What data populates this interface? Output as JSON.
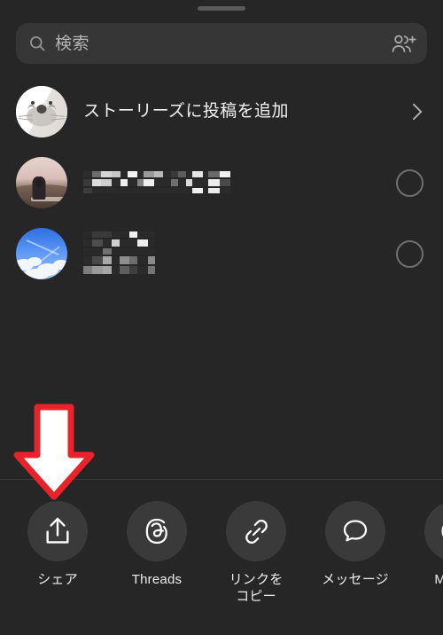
{
  "app": {
    "sheet_title": "share-sheet",
    "background_color": "#262626",
    "accent_color": "#e8232a"
  },
  "search": {
    "placeholder": "検索",
    "value": "",
    "search_icon": "search-icon",
    "add_people_icon": "add-people-icon"
  },
  "story_row": {
    "label": "ストーリーズに投稿を追加",
    "avatar_icon": "seal-avatar",
    "chevron_icon": "chevron-right-icon"
  },
  "contacts": [
    {
      "name_redacted": true,
      "name": "",
      "avatar_icon": "photo-avatar-person-landscape",
      "selector_icon": "unselected-circle-icon",
      "mosaic_lines": [
        [
          {
            "w": 10,
            "h": 7,
            "c": "#2d2d2d"
          },
          {
            "w": 10,
            "h": 7,
            "c": "#6d6d6d"
          },
          {
            "w": 12,
            "h": 7,
            "c": "#d6d6d6"
          },
          {
            "w": 10,
            "h": 7,
            "c": "#c8c8c8"
          },
          {
            "w": 8,
            "h": 7,
            "c": "#2a2a2a"
          },
          {
            "w": 11,
            "h": 7,
            "c": "#f2f2f2"
          },
          {
            "w": 7,
            "h": 7,
            "c": "#2a2a2a"
          },
          {
            "w": 12,
            "h": 7,
            "c": "#9a9a9a"
          },
          {
            "w": 10,
            "h": 7,
            "c": "#b9b9b9"
          },
          {
            "w": 9,
            "h": 7,
            "c": "#2b2b2b"
          },
          {
            "w": 8,
            "h": 7,
            "c": "#3a3a3a"
          },
          {
            "w": 9,
            "h": 7,
            "c": "#5c5c5c"
          },
          {
            "w": 7,
            "h": 7,
            "c": "#2a2a2a"
          },
          {
            "w": 12,
            "h": 7,
            "c": "#e6e6e6"
          },
          {
            "w": 6,
            "h": 7,
            "c": "#2c2c2c"
          },
          {
            "w": 13,
            "h": 7,
            "c": "#6a6a6a"
          },
          {
            "w": 12,
            "h": 7,
            "c": "#efefef"
          }
        ],
        [
          {
            "w": 10,
            "h": 8,
            "c": "#3a3a3a"
          },
          {
            "w": 10,
            "h": 8,
            "c": "#dedede"
          },
          {
            "w": 12,
            "h": 8,
            "c": "#cfcfcf"
          },
          {
            "w": 10,
            "h": 8,
            "c": "#2c2c2c"
          },
          {
            "w": 8,
            "h": 8,
            "c": "#ededed"
          },
          {
            "w": 11,
            "h": 8,
            "c": "#2b2b2b"
          },
          {
            "w": 7,
            "h": 8,
            "c": "#858585"
          },
          {
            "w": 12,
            "h": 8,
            "c": "#efefef"
          },
          {
            "w": 10,
            "h": 8,
            "c": "#2a2a2a"
          },
          {
            "w": 9,
            "h": 8,
            "c": "#2a2a2a"
          },
          {
            "w": 8,
            "h": 8,
            "c": "#6f6f6f"
          },
          {
            "w": 9,
            "h": 8,
            "c": "#2a2a2a"
          },
          {
            "w": 7,
            "h": 8,
            "c": "#dadada"
          },
          {
            "w": 12,
            "h": 8,
            "c": "#2b2b2b"
          },
          {
            "w": 6,
            "h": 8,
            "c": "#2c2c2c"
          },
          {
            "w": 13,
            "h": 8,
            "c": "#ececec"
          },
          {
            "w": 12,
            "h": 8,
            "c": "#4a4a4a"
          }
        ],
        [
          {
            "w": 10,
            "h": 6,
            "c": "#3d3d3d"
          },
          {
            "w": 10,
            "h": 6,
            "c": "#2b2b2b"
          },
          {
            "w": 12,
            "h": 6,
            "c": "#2b2b2b"
          },
          {
            "w": 10,
            "h": 6,
            "c": "#2a2a2a"
          },
          {
            "w": 8,
            "h": 6,
            "c": "#2a2a2a"
          },
          {
            "w": 11,
            "h": 6,
            "c": "#2a2a2a"
          },
          {
            "w": 7,
            "h": 6,
            "c": "#2a2a2a"
          },
          {
            "w": 12,
            "h": 6,
            "c": "#2a2a2a"
          },
          {
            "w": 10,
            "h": 6,
            "c": "#2a2a2a"
          },
          {
            "w": 9,
            "h": 6,
            "c": "#2a2a2a"
          },
          {
            "w": 8,
            "h": 6,
            "c": "#2a2a2a"
          },
          {
            "w": 9,
            "h": 6,
            "c": "#2a2a2a"
          },
          {
            "w": 7,
            "h": 6,
            "c": "#2a2a2a"
          },
          {
            "w": 12,
            "h": 6,
            "c": "#f0f0f0"
          },
          {
            "w": 6,
            "h": 6,
            "c": "#2a2a2a"
          },
          {
            "w": 13,
            "h": 6,
            "c": "#ececec"
          },
          {
            "w": 12,
            "h": 6,
            "c": "#2b2b2b"
          }
        ]
      ]
    },
    {
      "name_redacted": true,
      "name": "",
      "avatar_icon": "photo-avatar-blue-sky",
      "selector_icon": "unselected-circle-icon",
      "mosaic_lines": [
        [
          {
            "w": 10,
            "h": 7,
            "c": "#2a2a2a"
          },
          {
            "w": 12,
            "h": 7,
            "c": "#3b3b3b"
          },
          {
            "w": 10,
            "h": 7,
            "c": "#3a3a3a"
          },
          {
            "w": 9,
            "h": 7,
            "c": "#2b2b2b"
          },
          {
            "w": 11,
            "h": 7,
            "c": "#2a2a2a"
          },
          {
            "w": 9,
            "h": 7,
            "c": "#f0f0f0"
          },
          {
            "w": 12,
            "h": 7,
            "c": "#2b2b2b"
          },
          {
            "w": 8,
            "h": 7,
            "c": "#2a2a2a"
          }
        ],
        [
          {
            "w": 10,
            "h": 8,
            "c": "#2b2b2b"
          },
          {
            "w": 12,
            "h": 8,
            "c": "#4d4d4d"
          },
          {
            "w": 10,
            "h": 8,
            "c": "#2c2c2c"
          },
          {
            "w": 9,
            "h": 8,
            "c": "#cfcfcf"
          },
          {
            "w": 11,
            "h": 8,
            "c": "#2b2b2b"
          },
          {
            "w": 9,
            "h": 8,
            "c": "#2b2b2b"
          },
          {
            "w": 12,
            "h": 8,
            "c": "#ededed"
          },
          {
            "w": 8,
            "h": 8,
            "c": "#2a2a2a"
          }
        ],
        [
          {
            "w": 10,
            "h": 7,
            "c": "#2a2a2a"
          },
          {
            "w": 12,
            "h": 7,
            "c": "#2a2a2a"
          },
          {
            "w": 10,
            "h": 7,
            "c": "#6f6f6f"
          },
          {
            "w": 9,
            "h": 7,
            "c": "#2a2a2a"
          },
          {
            "w": 11,
            "h": 7,
            "c": "#2a2a2a"
          },
          {
            "w": 9,
            "h": 7,
            "c": "#2a2a2a"
          },
          {
            "w": 12,
            "h": 7,
            "c": "#2a2a2a"
          },
          {
            "w": 8,
            "h": 7,
            "c": "#2a2a2a"
          }
        ],
        [
          {
            "w": 10,
            "h": 9,
            "c": "#2b2b2b"
          },
          {
            "w": 12,
            "h": 9,
            "c": "#4a4a4a"
          },
          {
            "w": 10,
            "h": 9,
            "c": "#a8a8a8"
          },
          {
            "w": 9,
            "h": 9,
            "c": "#2a2a2a"
          },
          {
            "w": 11,
            "h": 9,
            "c": "#8e8e8e"
          },
          {
            "w": 9,
            "h": 9,
            "c": "#6c6c6c"
          },
          {
            "w": 12,
            "h": 9,
            "c": "#2a2a2a"
          },
          {
            "w": 8,
            "h": 9,
            "c": "#8a8a8a"
          }
        ],
        [
          {
            "w": 10,
            "h": 9,
            "c": "#7c7c7c"
          },
          {
            "w": 12,
            "h": 9,
            "c": "#9a9a9a"
          },
          {
            "w": 10,
            "h": 9,
            "c": "#a6a6a6"
          },
          {
            "w": 9,
            "h": 9,
            "c": "#2a2a2a"
          },
          {
            "w": 11,
            "h": 9,
            "c": "#5e5e5e"
          },
          {
            "w": 9,
            "h": 9,
            "c": "#3e3e3e"
          },
          {
            "w": 12,
            "h": 9,
            "c": "#2a2a2a"
          },
          {
            "w": 8,
            "h": 9,
            "c": "#747474"
          }
        ]
      ]
    }
  ],
  "share_targets": [
    {
      "label": "シェア",
      "icon": "share-upload-icon"
    },
    {
      "label": "Threads",
      "icon": "threads-icon"
    },
    {
      "label": "リンクを\nコピー",
      "icon": "link-icon"
    },
    {
      "label": "メッセージ",
      "icon": "message-bubble-icon"
    },
    {
      "label": "Messe",
      "icon": "messenger-icon"
    }
  ],
  "annotation": {
    "arrow_icon": "down-arrow-annotation",
    "fill_color": "#ffffff",
    "stroke_color": "#e8232a",
    "points_to": "シェア"
  }
}
